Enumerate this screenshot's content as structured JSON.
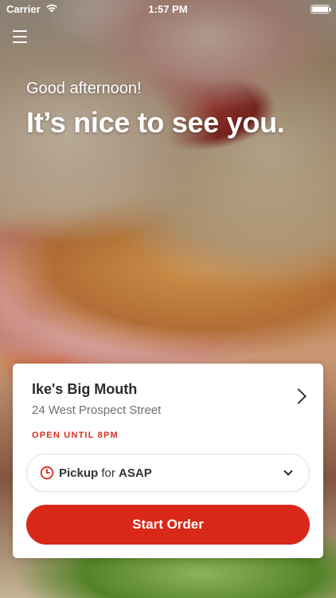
{
  "status_bar": {
    "carrier": "Carrier",
    "time": "1:57 PM"
  },
  "greeting": {
    "subtitle": "Good afternoon!",
    "title": "It’s nice to see you."
  },
  "store": {
    "name": "Ike's Big Mouth",
    "address": "24 West Prospect Street",
    "hours": "OPEN UNTIL 8PM"
  },
  "order": {
    "method": "Pickup",
    "connector": "for",
    "time": "ASAP",
    "start_label": "Start Order"
  },
  "colors": {
    "accent": "#d9281a",
    "hours_text": "#d9301f"
  },
  "icons": [
    "wifi-icon",
    "battery-icon",
    "menu-icon",
    "chevron-right-icon",
    "clock-icon",
    "chevron-down-icon"
  ]
}
